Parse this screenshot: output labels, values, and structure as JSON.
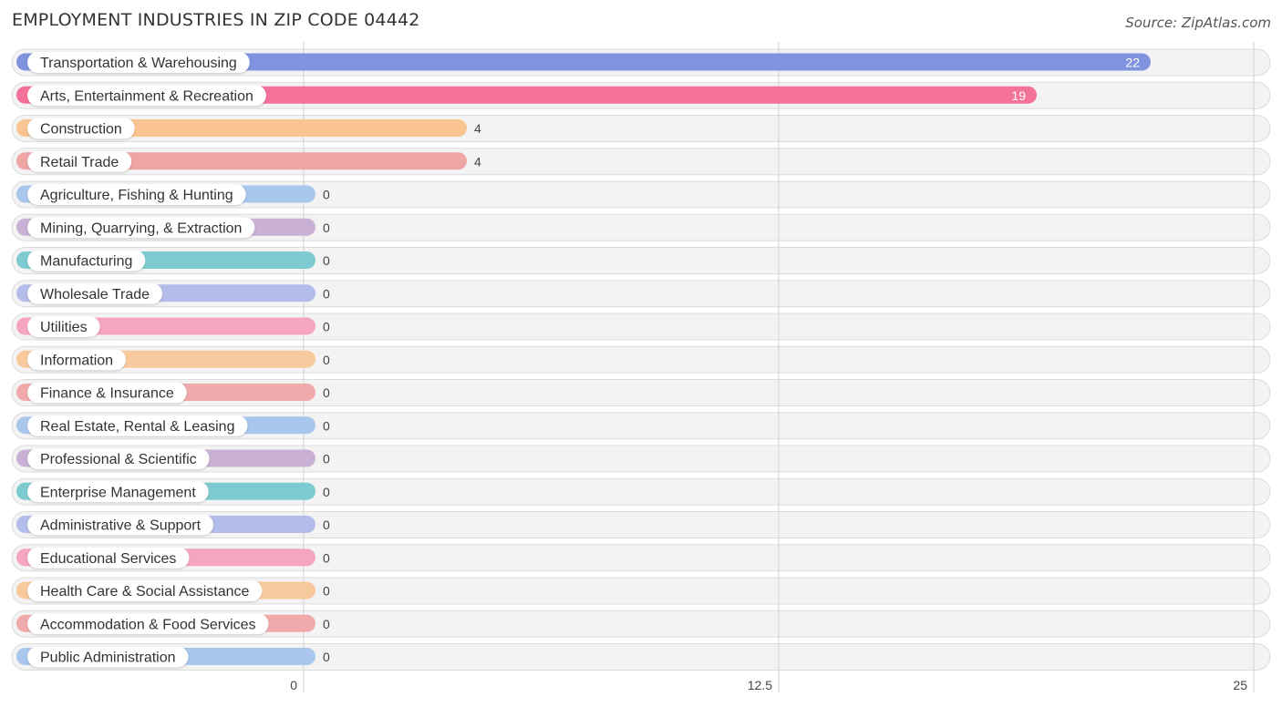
{
  "chart_data": {
    "type": "bar",
    "orientation": "horizontal",
    "title": "EMPLOYMENT INDUSTRIES IN ZIP CODE 04442",
    "source": "Source: ZipAtlas.com",
    "xlabel": "",
    "ylabel": "",
    "xlim": [
      0,
      25
    ],
    "ticks": [
      0,
      12.5,
      25
    ],
    "tick_labels": [
      "0",
      "12.5",
      "25"
    ],
    "grid": true,
    "categories": [
      "Transportation & Warehousing",
      "Arts, Entertainment & Recreation",
      "Construction",
      "Retail Trade",
      "Agriculture, Fishing & Hunting",
      "Mining, Quarrying, & Extraction",
      "Manufacturing",
      "Wholesale Trade",
      "Utilities",
      "Information",
      "Finance & Insurance",
      "Real Estate, Rental & Leasing",
      "Professional & Scientific",
      "Enterprise Management",
      "Administrative & Support",
      "Educational Services",
      "Health Care & Social Assistance",
      "Accommodation & Food Services",
      "Public Administration"
    ],
    "values": [
      22,
      19,
      4,
      4,
      0,
      0,
      0,
      0,
      0,
      0,
      0,
      0,
      0,
      0,
      0,
      0,
      0,
      0,
      0
    ],
    "value_labels": [
      "22",
      "19",
      "4",
      "4",
      "0",
      "0",
      "0",
      "0",
      "0",
      "0",
      "0",
      "0",
      "0",
      "0",
      "0",
      "0",
      "0",
      "0",
      "0"
    ],
    "colors": [
      "#7f93de",
      "#f4719a",
      "#f9c48f",
      "#eea5a3",
      "#a9c6ec",
      "#c9b0d4",
      "#7dcbd0",
      "#b4bdea",
      "#f6a5c1",
      "#f9c99e",
      "#f0aaab",
      "#a9c6ec",
      "#c9b0d4",
      "#7dcbd0",
      "#b4bdea",
      "#f6a5c1",
      "#f9c99e",
      "#f0aaab",
      "#a9c6ec"
    ]
  }
}
